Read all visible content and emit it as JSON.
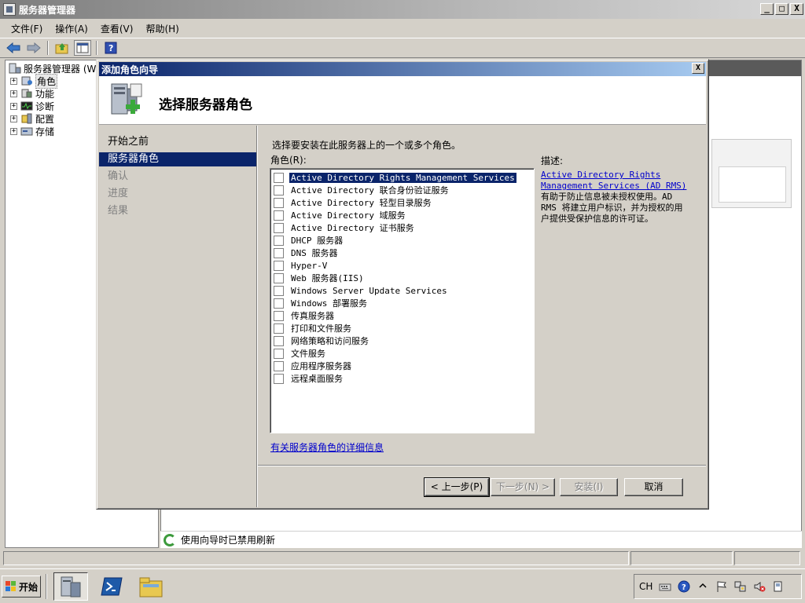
{
  "window": {
    "title": "服务器管理器",
    "controls": {
      "minimize": "_",
      "maximize": "□",
      "close": "X"
    }
  },
  "menu": [
    "文件(F)",
    "操作(A)",
    "查看(V)",
    "帮助(H)"
  ],
  "tree": {
    "root": "服务器管理器 (W",
    "items": [
      "角色",
      "功能",
      "诊断",
      "配置",
      "存储"
    ]
  },
  "status_message": "使用向导时已禁用刷新",
  "wizard": {
    "title": "添加角色向导",
    "close": "X",
    "header_title": "选择服务器角色",
    "nav": [
      {
        "label": "开始之前",
        "state": "normal"
      },
      {
        "label": "服务器角色",
        "state": "current"
      },
      {
        "label": "确认",
        "state": "disabled"
      },
      {
        "label": "进度",
        "state": "disabled"
      },
      {
        "label": "结果",
        "state": "disabled"
      }
    ],
    "instruction": "选择要安装在此服务器上的一个或多个角色。",
    "roles_label": "角色(R):",
    "roles": [
      {
        "label": "Active Directory Rights Management Services",
        "checked": false,
        "selected": true
      },
      {
        "label": "Active Directory 联合身份验证服务",
        "checked": false,
        "selected": false
      },
      {
        "label": "Active Directory 轻型目录服务",
        "checked": false,
        "selected": false
      },
      {
        "label": "Active Directory 域服务",
        "checked": false,
        "selected": false
      },
      {
        "label": "Active Directory 证书服务",
        "checked": false,
        "selected": false
      },
      {
        "label": "DHCP 服务器",
        "checked": false,
        "selected": false
      },
      {
        "label": "DNS 服务器",
        "checked": false,
        "selected": false
      },
      {
        "label": "Hyper-V",
        "checked": false,
        "selected": false
      },
      {
        "label": "Web 服务器(IIS)",
        "checked": false,
        "selected": false
      },
      {
        "label": "Windows Server Update Services",
        "checked": false,
        "selected": false
      },
      {
        "label": "Windows 部署服务",
        "checked": false,
        "selected": false
      },
      {
        "label": "传真服务器",
        "checked": false,
        "selected": false
      },
      {
        "label": "打印和文件服务",
        "checked": false,
        "selected": false
      },
      {
        "label": "网络策略和访问服务",
        "checked": false,
        "selected": false
      },
      {
        "label": "文件服务",
        "checked": false,
        "selected": false
      },
      {
        "label": "应用程序服务器",
        "checked": false,
        "selected": false
      },
      {
        "label": "远程桌面服务",
        "checked": false,
        "selected": false
      }
    ],
    "description_label": "描述:",
    "description_link": "Active Directory Rights Management Services (AD RMS)",
    "description_text": "有助于防止信息被未授权使用。AD RMS 将建立用户标识，并为授权的用户提供受保护信息的许可证。",
    "more_info_link": "有关服务器角色的详细信息",
    "buttons": {
      "back": "< 上一步(P)",
      "next": "下一步(N) >",
      "install": "安装(I)",
      "cancel": "取消"
    }
  },
  "taskbar": {
    "start": "开始",
    "tray_lang": "CH"
  },
  "colors": {
    "selection": "#0a246a",
    "link": "#0000cc",
    "face": "#d4d0c8"
  }
}
